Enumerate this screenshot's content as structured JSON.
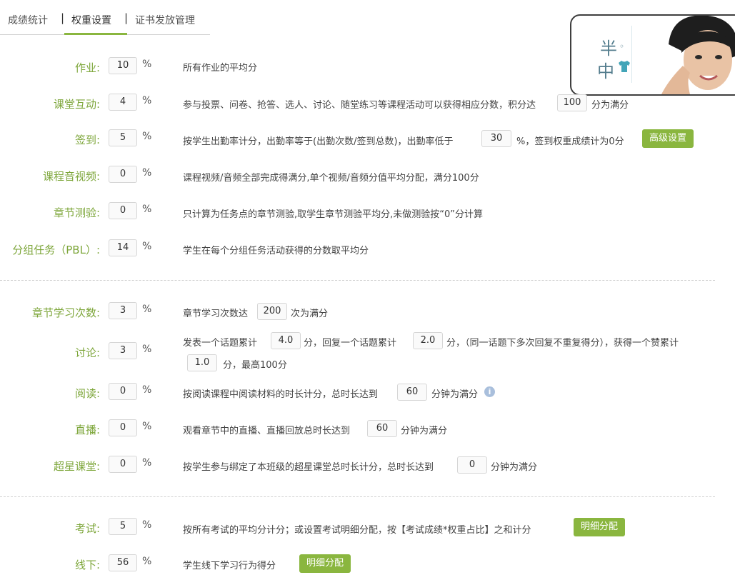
{
  "tabs": [
    {
      "label": "成绩统计",
      "active": false
    },
    {
      "label": "权重设置",
      "active": true
    },
    {
      "label": "证书发放管理",
      "active": false
    }
  ],
  "tab_separator": "|",
  "accent_color": "#8ab63f",
  "label_color": "#7da63a",
  "avatar_card": {
    "logo_text_top": "半",
    "logo_text_bottom": "中",
    "icon": "t-shirt-icon"
  },
  "percent_sign": "%",
  "rows": {
    "homework": {
      "label": "作业:",
      "value": "10",
      "desc": "所有作业的平均分"
    },
    "interaction": {
      "label": "课堂互动:",
      "value": "4",
      "desc_a": "参与投票、问卷、抢答、选人、讨论、随堂练习等课程活动可以获得相应分数，积分达",
      "score": "100",
      "desc_b": "分为满分"
    },
    "signin": {
      "label": "签到:",
      "value": "5",
      "desc_a": "按学生出勤率计分，出勤率等于(出勤次数/签到总数)，出勤率低于",
      "threshold": "30",
      "desc_b": "%，签到权重成绩计为0分",
      "button": "高级设置"
    },
    "video": {
      "label": "课程音视频:",
      "value": "0",
      "desc": "课程视频/音频全部完成得满分,单个视频/音频分值平均分配，满分100分"
    },
    "chapter_quiz": {
      "label": "章节测验:",
      "value": "0",
      "desc": "只计算为任务点的章节测验,取学生章节测验平均分,未做测验按“0”分计算"
    },
    "pbl": {
      "label": "分组任务（PBL）:",
      "value": "14",
      "desc": "学生在每个分组任务活动获得的分数取平均分"
    },
    "chapter_study": {
      "label": "章节学习次数:",
      "value": "3",
      "desc_a": "章节学习次数达",
      "times": "200",
      "desc_b": "次为满分"
    },
    "discussion": {
      "label": "讨论:",
      "value": "3",
      "desc_a": "发表一个话题累计",
      "topic_score": "4.0",
      "desc_b": "分，回复一个话题累计",
      "reply_score": "2.0",
      "desc_c": "分，（同一话题下多次回复不重复得分），获得一个赞累计",
      "like_score": "1.0",
      "desc_d": "分，最高100分"
    },
    "reading": {
      "label": "阅读:",
      "value": "0",
      "desc_a": "按阅读课程中阅读材料的时长计分，总时长达到",
      "minutes": "60",
      "desc_b": "分钟为满分"
    },
    "live": {
      "label": "直播:",
      "value": "0",
      "desc_a": "观看章节中的直播、直播回放总时长达到",
      "minutes": "60",
      "desc_b": "分钟为满分"
    },
    "superstar": {
      "label": "超星课堂:",
      "value": "0",
      "desc_a": "按学生参与绑定了本班级的超星课堂总时长计分，总时长达到",
      "minutes": "0",
      "desc_b": "分钟为满分"
    },
    "exam": {
      "label": "考试:",
      "value": "5",
      "desc": "按所有考试的平均分计分；或设置考试明细分配，按【考试成绩*权重占比】之和计分",
      "button": "明细分配"
    },
    "offline": {
      "label": "线下:",
      "value": "56",
      "desc": "学生线下学习行为得分",
      "button": "明细分配"
    }
  }
}
